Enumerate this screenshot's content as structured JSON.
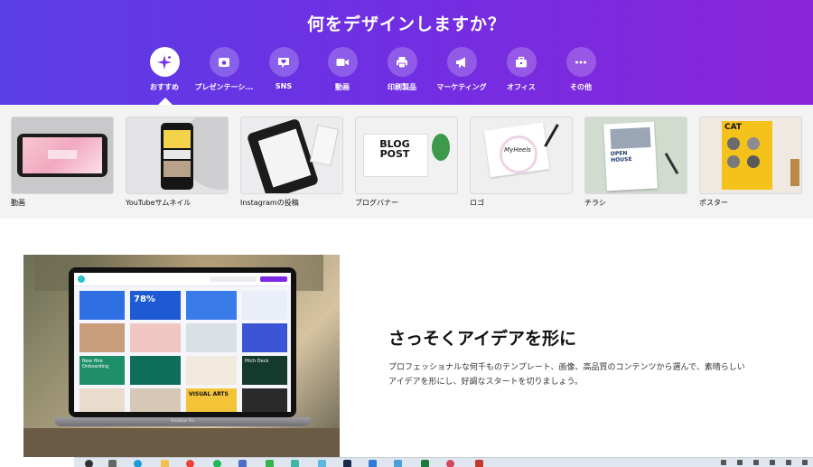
{
  "hero": {
    "title": "何をデザインしますか？",
    "gradient": [
      "#5a3ee6",
      "#8a24d9"
    ],
    "categories": [
      {
        "label": "おすすめ",
        "icon": "sparkle-icon",
        "active": true
      },
      {
        "label": "プレゼンテーシ...",
        "icon": "presentation-icon",
        "active": false
      },
      {
        "label": "SNS",
        "icon": "heart-chat-icon",
        "active": false
      },
      {
        "label": "動画",
        "icon": "video-camera-icon",
        "active": false
      },
      {
        "label": "印刷製品",
        "icon": "printer-icon",
        "active": false
      },
      {
        "label": "マーケティング",
        "icon": "megaphone-icon",
        "active": false
      },
      {
        "label": "オフィス",
        "icon": "briefcase-icon",
        "active": false
      },
      {
        "label": "その他",
        "icon": "more-dots-icon",
        "active": false
      }
    ]
  },
  "templates": [
    {
      "label": "動画",
      "thumb_text": ""
    },
    {
      "label": "YouTubeサムネイル",
      "thumb_text": ""
    },
    {
      "label": "Instagramの投稿",
      "thumb_text": ""
    },
    {
      "label": "ブログバナー",
      "thumb_text": "BLOG POST"
    },
    {
      "label": "ロゴ",
      "thumb_text": "MyHeels"
    },
    {
      "label": "チラシ",
      "thumb_text": "OPEN HOUSE"
    },
    {
      "label": "ポスター",
      "thumb_text": "CAT"
    }
  ],
  "feature": {
    "title": "さっそくアイデアを形に",
    "description": "プロフェッショナルな何千ものテンプレート、画像、高品質のコンテンツから選んで、素晴らしいアイデアを形にし、好調なスタートを切りましょう。",
    "laptop_labels": {
      "stat": "78%",
      "tile_a": "New Hire Onboarding",
      "tile_b": "Pitch Deck",
      "tile_c": "VISUAL ARTS",
      "brand": "MacBook Pro"
    }
  },
  "taskbar": {
    "icons": [
      "search-icon",
      "task-view-icon",
      "edge-icon",
      "folder-icon",
      "chrome-icon",
      "line-icon",
      "store-icon",
      "teams-icon",
      "slack-icon",
      "mail-icon",
      "calendar-icon",
      "app-icon",
      "excel-icon",
      "app-icon",
      "app-icon"
    ]
  }
}
